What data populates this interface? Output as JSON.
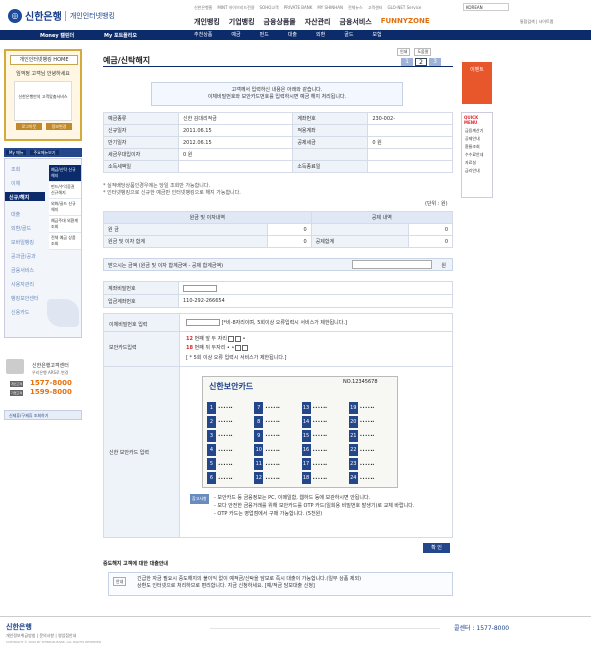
{
  "header": {
    "bank_name": "신한은행",
    "portal": "개인인터넷뱅킹",
    "toplinks": [
      "신한은행홈",
      "MINT 하이브리드전용",
      "SOHO고객",
      "PRIVATE BANK",
      "MY SHINHAN",
      "전체뉴스",
      "고객센터",
      "GLO-NET Service"
    ],
    "language": "KOREAN",
    "right_links": "통합검색 | 사이트맵",
    "main_nav": [
      "개인뱅킹",
      "기업뱅킹",
      "금융상품몰",
      "자산관리",
      "금융서비스"
    ],
    "funzone": "FUNNYZONE"
  },
  "menubar": {
    "money": "Money 캘린더",
    "my": "My 포트폴리오"
  },
  "subnav": [
    "추천상품",
    "예금",
    "펀드",
    "대출",
    "외환",
    "골드",
    "보험"
  ],
  "left": {
    "home": "개인인터넷뱅킹 HOME",
    "greeting": "임꺽정 고객님 안녕하세요",
    "panel": "신한은행만의 고객맞춤서비스",
    "btn1": "로그아웃",
    "btn2": "정보변경",
    "menu_tabs": [
      "My 메뉴",
      "주요메뉴보기"
    ],
    "items": [
      "조회",
      "이체",
      "신규/해지",
      "대출",
      "외환/골드",
      "모바일뱅킹",
      "공과금/공과",
      "금융서비스",
      "사용자관리",
      "뱅킹보안센터",
      "신용카드"
    ],
    "sub": [
      "예금/신탁 신규해지",
      "펀드/수익증권 신규해지",
      "외화/골드 신규해지",
      "예금주대 외환계 조회",
      "전체 예금 상품조회"
    ],
    "cc_name": "신한은행고객센터",
    "cc_sub": "우리은행 ARS로 변경",
    "cc_num1": "1577-8000",
    "cc_num2": "1599-8000",
    "cc_label1": "개인고객",
    "cc_label2": "기업고객",
    "cardreq": "신제휴/구제휴 조회하기"
  },
  "right": {
    "event": "이벤트",
    "quick_title": "QUICK MENU",
    "quick": [
      "금융계산기",
      "공제안내",
      "환율조회",
      "수수료안내",
      "자료실",
      "금리안내"
    ]
  },
  "page": {
    "title": "예금/신탁해지",
    "btn_print": "인쇄",
    "btn_help": "도움말",
    "steps": [
      "1",
      "2",
      "3"
    ],
    "notice1": "고객께서 입력하신 내용은 아래와 같습니다.",
    "notice2": "이체비밀번호와 보안카드번호를 입력하시면 예금 해지 처리됩니다."
  },
  "info": [
    [
      "예금종류",
      "신한 김대리적금",
      "계좌번호",
      "230-002-"
    ],
    [
      "신규일자",
      "2011.06.15",
      "적용계좌",
      ""
    ],
    [
      "만기일자",
      "2012.06.15",
      "공제세금",
      "0 원"
    ],
    [
      "세금우대입이자",
      "0 원",
      "",
      ""
    ],
    [
      "소득세액일",
      "",
      "소득종료일",
      ""
    ]
  ],
  "notes": [
    "* 실적배당상품인경우에는 당일 조회만 가능합니다.",
    "* 인터넷뱅킹으로 신규한 예금만 인터넷뱅킹으로 해지 가능합니다."
  ],
  "unit": "(단위 : 원)",
  "t2": {
    "h1": "원금 및 이자내역",
    "h2": "공제 내역",
    "r1": "원 금",
    "v1": "0",
    "r2": "원금 및 이자 합계",
    "v2": "0",
    "r3": "공제합계",
    "v3": "0"
  },
  "sum": {
    "label": "받으시는 금액 (원금 및 이자 합계금액 - 공제 합계금액)",
    "unit": "원"
  },
  "acct": [
    [
      "계좌비밀번호",
      ""
    ],
    [
      "입금계좌번호",
      "110-292-266654"
    ]
  ],
  "auth": {
    "pw_label": "이체비밀번호 입력",
    "pw_hint": "[*비-8자리이며, 5회이상 오류입력시 서비스가 제한됩니다.]",
    "sc_label": "보안카드입력",
    "r12": "12",
    "r18": "18",
    "sec1": "번째 앞 두 자리",
    "sec2": "번째 뒤 두자리",
    "sc_hint": "[ * 5회 이상 오류 입력시 서비스가 제한됩니다.]",
    "card_label": "신한 보안카드 입력",
    "card_title": "신한보안카드",
    "card_no": "NO.12345678",
    "otp_badge": "참고사항",
    "otp": [
      "- 보안카드 등 금융정보는 PC, 이메일함, 웹하드 등에 보관하시면 안됩니다.",
      "- 보다 안전한 금융거래를 위해 보안카드를 OTP 카드(일회용 비밀번호 발생기)로 교체 바랍니다.",
      "- OTP 카드는 영업점에서 구매 가능합니다. (5천원)"
    ]
  },
  "ok": "확 인",
  "anno": {
    "title": "중도해지 고객에 대한 대출안내",
    "tag": "안내",
    "line1": "긴급한 자금 필요시 중도해지의 불이익 없이 예적금/신탁을 담보로 즉시 대출이 가능합니다.(일부 상품 제외)",
    "line2": "상환도 인터넷으로 처리하므로 편리합니다. 지금 신청하세요. [예/적금 담보대출 신청]"
  },
  "footer": {
    "logo": "신한은행",
    "links": "개인정보취급방침 | 문의사항 | 영업점안내",
    "copy": "COPYRIGHT © 2009 BY SHINHAN BANK, ALL RIGHTS RESERVED",
    "phone": "콜센터 : 1577-8000"
  }
}
